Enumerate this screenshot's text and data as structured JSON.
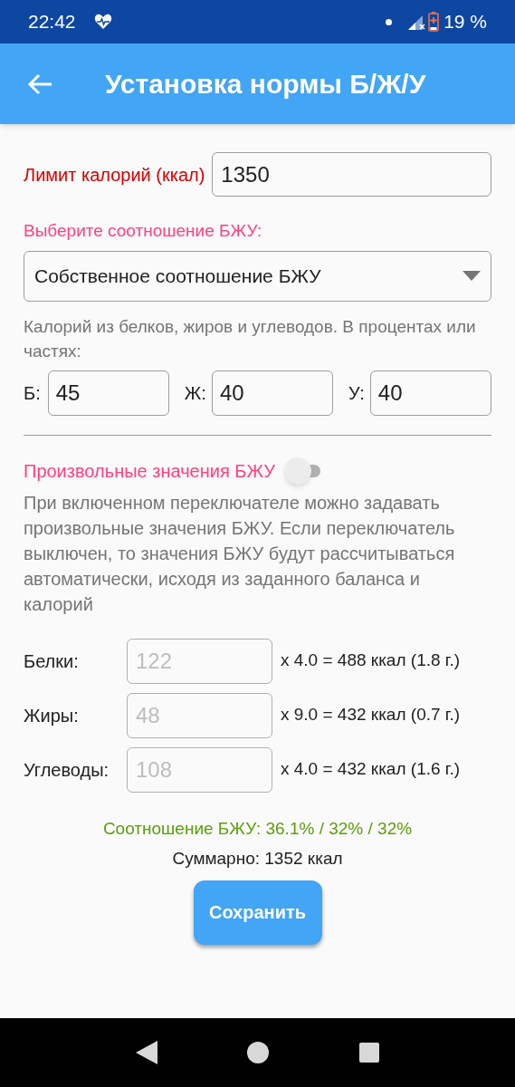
{
  "status_bar": {
    "time": "22:42",
    "battery": "19 %"
  },
  "app_bar": {
    "title": "Установка нормы Б/Ж/У"
  },
  "calorie_limit": {
    "label": "Лимит калорий (ккал)",
    "value": "1350"
  },
  "ratio_select": {
    "label": "Выберите соотношение БЖУ:",
    "value": "Собственное соотношение БЖУ"
  },
  "ratio_hint": "Калорий из белков, жиров и углеводов. В процентах или частях:",
  "ratio_fields": [
    {
      "label": "Б:",
      "value": "45"
    },
    {
      "label": "Ж:",
      "value": "40"
    },
    {
      "label": "У:",
      "value": "40"
    }
  ],
  "custom_toggle": {
    "label": "Произвольные значения БЖУ",
    "on": false
  },
  "custom_hint": "При включенном переключателе можно задавать произвольные значения БЖУ. Если переключатель выключен, то значения БЖУ будут рассчитываться автоматически, исходя из заданного баланса и калорий",
  "macros": [
    {
      "label": "Белки:",
      "value": "122",
      "disabled": true,
      "formula": "x 4.0 = 488 ккал (1.8 г.)"
    },
    {
      "label": "Жиры:",
      "value": "48",
      "disabled": true,
      "formula": "x 9.0 = 432 ккал (0.7 г.)"
    },
    {
      "label": "Углеводы:",
      "value": "108",
      "disabled": true,
      "formula": "x 4.0 = 432 ккал (1.6 г.)"
    }
  ],
  "ratio_summary": "Соотношение БЖУ: 36.1% / 32% / 32%",
  "total": "Суммарно: 1352 ккал",
  "save_button": "Сохранить"
}
